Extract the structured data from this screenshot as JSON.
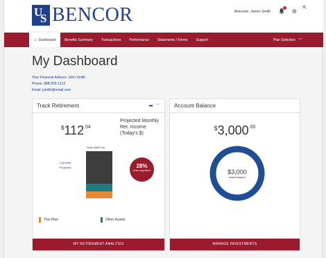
{
  "header": {
    "logo_letters": "US",
    "logo_text": "BENCOR",
    "welcome": "Welcome, James Smith",
    "icons": [
      "bell-icon",
      "gear-icon",
      "logout-icon"
    ],
    "brand_color": "#1f3f8f",
    "accent_color": "#9b1b2e"
  },
  "nav": {
    "items": [
      {
        "label": "Dashboard",
        "icon": "home-icon",
        "active": true
      },
      {
        "label": "Benefits Summary"
      },
      {
        "label": "Transactions"
      },
      {
        "label": "Performance"
      },
      {
        "label": "Statements / Forms"
      },
      {
        "label": "Support"
      }
    ],
    "plan_selection": "Plan Selection"
  },
  "page": {
    "title": "My Dashboard",
    "advisor": "Your Financial Advisor: John Smith",
    "phone": "Phone: 888-555-1212",
    "email": "Email: jsmith@email.com"
  },
  "track": {
    "title": "Track Retirement",
    "currency": "$",
    "amount": "112",
    "cents": ".04",
    "projected_label": "Projected Monthly Ret. Income (Today's $)",
    "goal": "Goal: $400 mo.",
    "currently_projected": "Currently Projected",
    "percent": "28%",
    "percent_text": "of the way there!",
    "legend": [
      {
        "label": "This Plan",
        "color": "#e58a3c"
      },
      {
        "label": "Other Assets",
        "color": "#1f7c86"
      }
    ],
    "button": "MY RETIREMENT ANALYSIS"
  },
  "balance": {
    "title": "Account Balance",
    "currency": "$",
    "amount": "3,000",
    "cents": ".00",
    "donut_value": "$3,000",
    "donut_label": "Vested Balance",
    "donut_color": "#1f4e96",
    "button": "MANAGE INVESTMENTS"
  }
}
